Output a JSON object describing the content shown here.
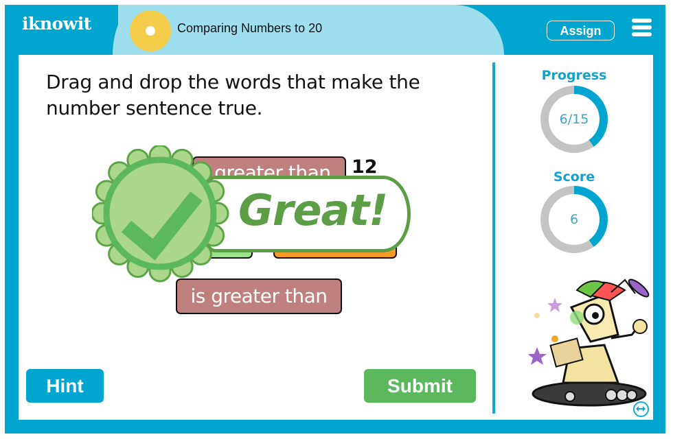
{
  "header": {
    "logo_text": "iknowit",
    "topic_title": "Comparing Numbers to 20",
    "assign_label": "Assign",
    "menu_icon": "hamburger-menu-icon"
  },
  "question": {
    "instructions": "Drag and drop the words that make the number sentence true.",
    "sentence": {
      "dropped_word": "is greater than",
      "visible_fragment": "greater than",
      "right_number": "12"
    },
    "answer_tiles": [
      {
        "label": "",
        "color": "#9be38a"
      },
      {
        "label": "",
        "color": "#f49a24"
      }
    ],
    "word_bank": [
      {
        "label": "is greater than",
        "color": "#c08080"
      }
    ]
  },
  "feedback": {
    "message": "Great!",
    "icon": "checkmark-badge-icon",
    "color": "#5b9e46"
  },
  "buttons": {
    "hint_label": "Hint",
    "submit_label": "Submit"
  },
  "sidebar": {
    "progress": {
      "label": "Progress",
      "value_text": "6/15",
      "current": 6,
      "total": 15
    },
    "score": {
      "label": "Score",
      "value_text": "6",
      "fraction": 0.4
    },
    "toggle_icon": "double-arrow-icon"
  },
  "colors": {
    "brand_blue": "#00a6cf",
    "header_light_blue": "#9edfee",
    "topic_yellow": "#f5cd4b",
    "submit_green": "#5cb85c",
    "ring_track": "#c4c4c4"
  }
}
